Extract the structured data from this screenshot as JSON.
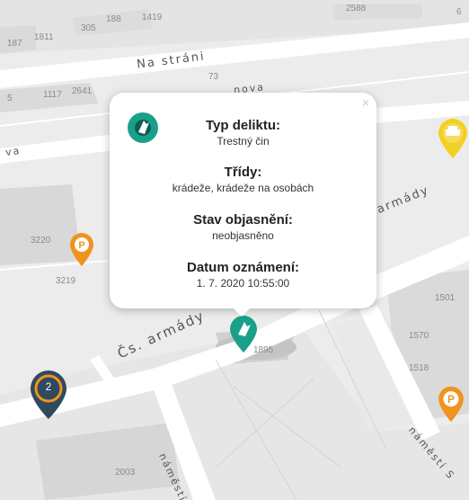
{
  "map": {
    "streets": {
      "na_strani": "Na stráni",
      "novaya_fragment": "nova",
      "cs_armady": "Čs. armády",
      "armady_right": "armády",
      "va_left": "va",
      "namesti_bottom": "náměstí",
      "namesti_right": "náměstí S"
    },
    "building_numbers": {
      "n187": "187",
      "n1811": "1811",
      "n305": "305",
      "n188": "188",
      "n1419": "1419",
      "n2588": "2588",
      "n6": "6",
      "n73": "73",
      "n1117": "1117",
      "n2641": "2641",
      "n5": "5",
      "n3220": "3220",
      "n3219": "3219",
      "n1501": "1501",
      "n1570": "1570",
      "n1518": "1518",
      "n1895": "1895",
      "n2003": "2003"
    }
  },
  "popup": {
    "crime_type_label": "Typ deliktu:",
    "crime_type_value": "Trestný čin",
    "classes_label": "Třídy:",
    "classes_value": "krádeže, krádeže na osobách",
    "status_label": "Stav objasnění:",
    "status_value": "neobjasněno",
    "date_label": "Datum oznámení:",
    "date_value": "1. 7. 2020 10:55:00",
    "close_glyph": "×"
  },
  "markers": {
    "cluster_count": "2",
    "parking_glyph": "P"
  },
  "colors": {
    "theft_marker": "#1aa08a",
    "parking_marker": "#f0931e",
    "car_marker": "#f2d024",
    "cluster_fill": "#2f4a5e",
    "cluster_ring": "#f0931e"
  }
}
